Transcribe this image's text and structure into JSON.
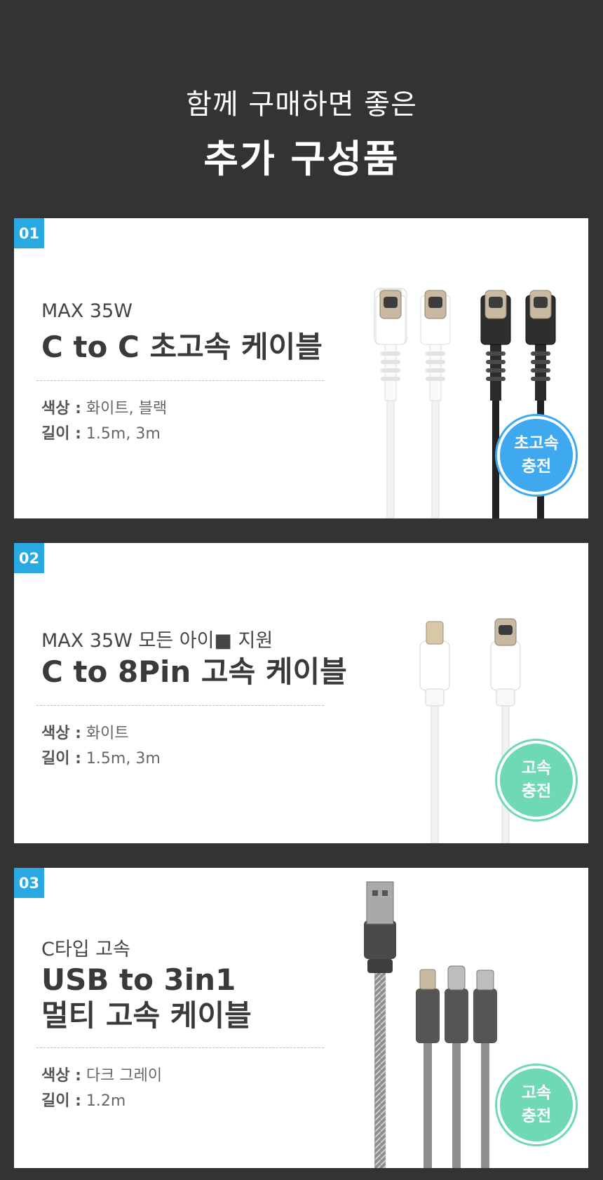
{
  "header": {
    "subtitle": "함께 구매하면 좋은",
    "title": "추가 구성품"
  },
  "cards": [
    {
      "number": "01",
      "tag": "MAX 35W",
      "title_lines": [
        "C to C 초고속 케이블"
      ],
      "specs": [
        {
          "label": "색상 :",
          "value": " 화이트, 블랙"
        },
        {
          "label": "길이 :",
          "value": " 1.5m, 3m"
        }
      ],
      "badge": {
        "line1": "초고속",
        "line2": "충전",
        "color": "#3fa9f0"
      }
    },
    {
      "number": "02",
      "tag": "MAX 35W 모든 아이■  지원",
      "title_lines": [
        "C to 8Pin 고속 케이블"
      ],
      "specs": [
        {
          "label": "색상 :",
          "value": " 화이트"
        },
        {
          "label": "길이 :",
          "value": " 1.5m, 3m"
        }
      ],
      "badge": {
        "line1": "고속",
        "line2": "충전",
        "color": "#6fd8b4"
      }
    },
    {
      "number": "03",
      "tag": "C타입 고속",
      "title_lines": [
        "USB to 3in1",
        "멀티 고속 케이블"
      ],
      "specs": [
        {
          "label": "색상 :",
          "value": " 다크 그레이"
        },
        {
          "label": "길이 :",
          "value": " 1.2m"
        }
      ],
      "badge": {
        "line1": "고속",
        "line2": "충전",
        "color": "#6fd8b4"
      }
    }
  ]
}
